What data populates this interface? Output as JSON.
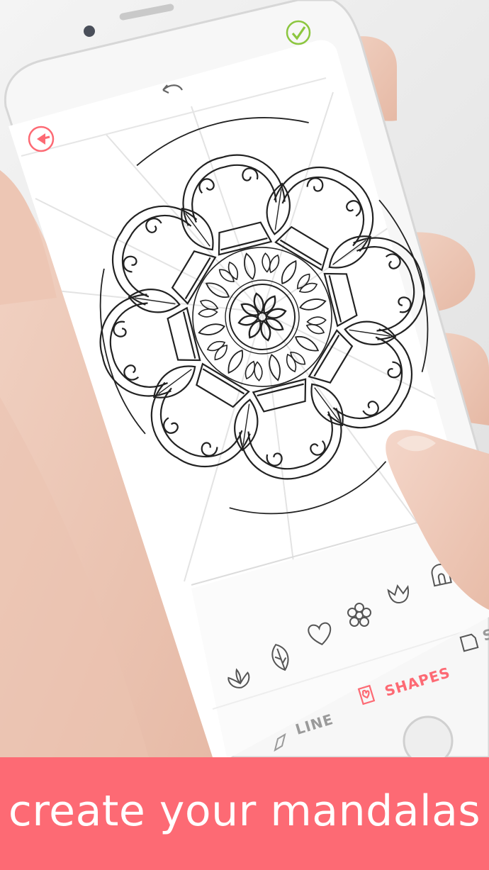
{
  "caption": "create your mandalas",
  "toolbar": {
    "line_label": "LINE",
    "shapes_label": "SHAPES",
    "shapes_label_cut": "S"
  },
  "colors": {
    "accent": "#fd6a74",
    "confirm": "#8cc63f",
    "inactive": "#9a9a9a"
  },
  "icons": {
    "back": "back-arrow-icon",
    "undo": "undo-icon",
    "confirm": "checkmark-icon",
    "shapes": [
      "lotus-icon",
      "leaf-icon",
      "heart-icon",
      "flower-icon",
      "tulip-icon",
      "arch-icon"
    ]
  }
}
